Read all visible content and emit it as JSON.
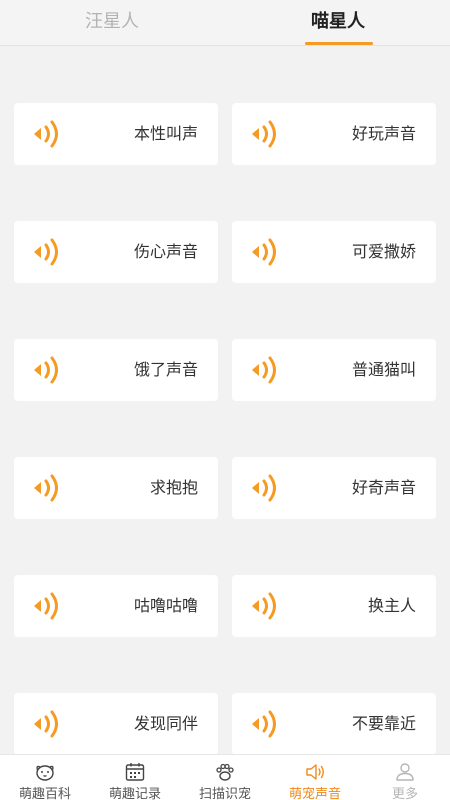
{
  "top_tabs": [
    {
      "label": "汪星人",
      "active": false
    },
    {
      "label": "喵星人",
      "active": true
    }
  ],
  "accent_color": "#f59a23",
  "sound_icon": "speaker-icon",
  "sounds": [
    {
      "label": "本性叫声"
    },
    {
      "label": "好玩声音"
    },
    {
      "label": "伤心声音"
    },
    {
      "label": "可爱撒娇"
    },
    {
      "label": "饿了声音"
    },
    {
      "label": "普通猫叫"
    },
    {
      "label": "求抱抱"
    },
    {
      "label": "好奇声音"
    },
    {
      "label": "咕噜咕噜"
    },
    {
      "label": "换主人"
    },
    {
      "label": "发现同伴"
    },
    {
      "label": "不要靠近"
    }
  ],
  "bottom_nav": [
    {
      "label": "萌趣百科",
      "icon": "pet-face-icon",
      "active": false
    },
    {
      "label": "萌趣记录",
      "icon": "calendar-icon",
      "active": false
    },
    {
      "label": "扫描识宠",
      "icon": "paw-icon",
      "active": false
    },
    {
      "label": "萌宠声音",
      "icon": "speaker-icon",
      "active": true
    },
    {
      "label": "更多",
      "icon": "person-icon",
      "active": false
    }
  ]
}
